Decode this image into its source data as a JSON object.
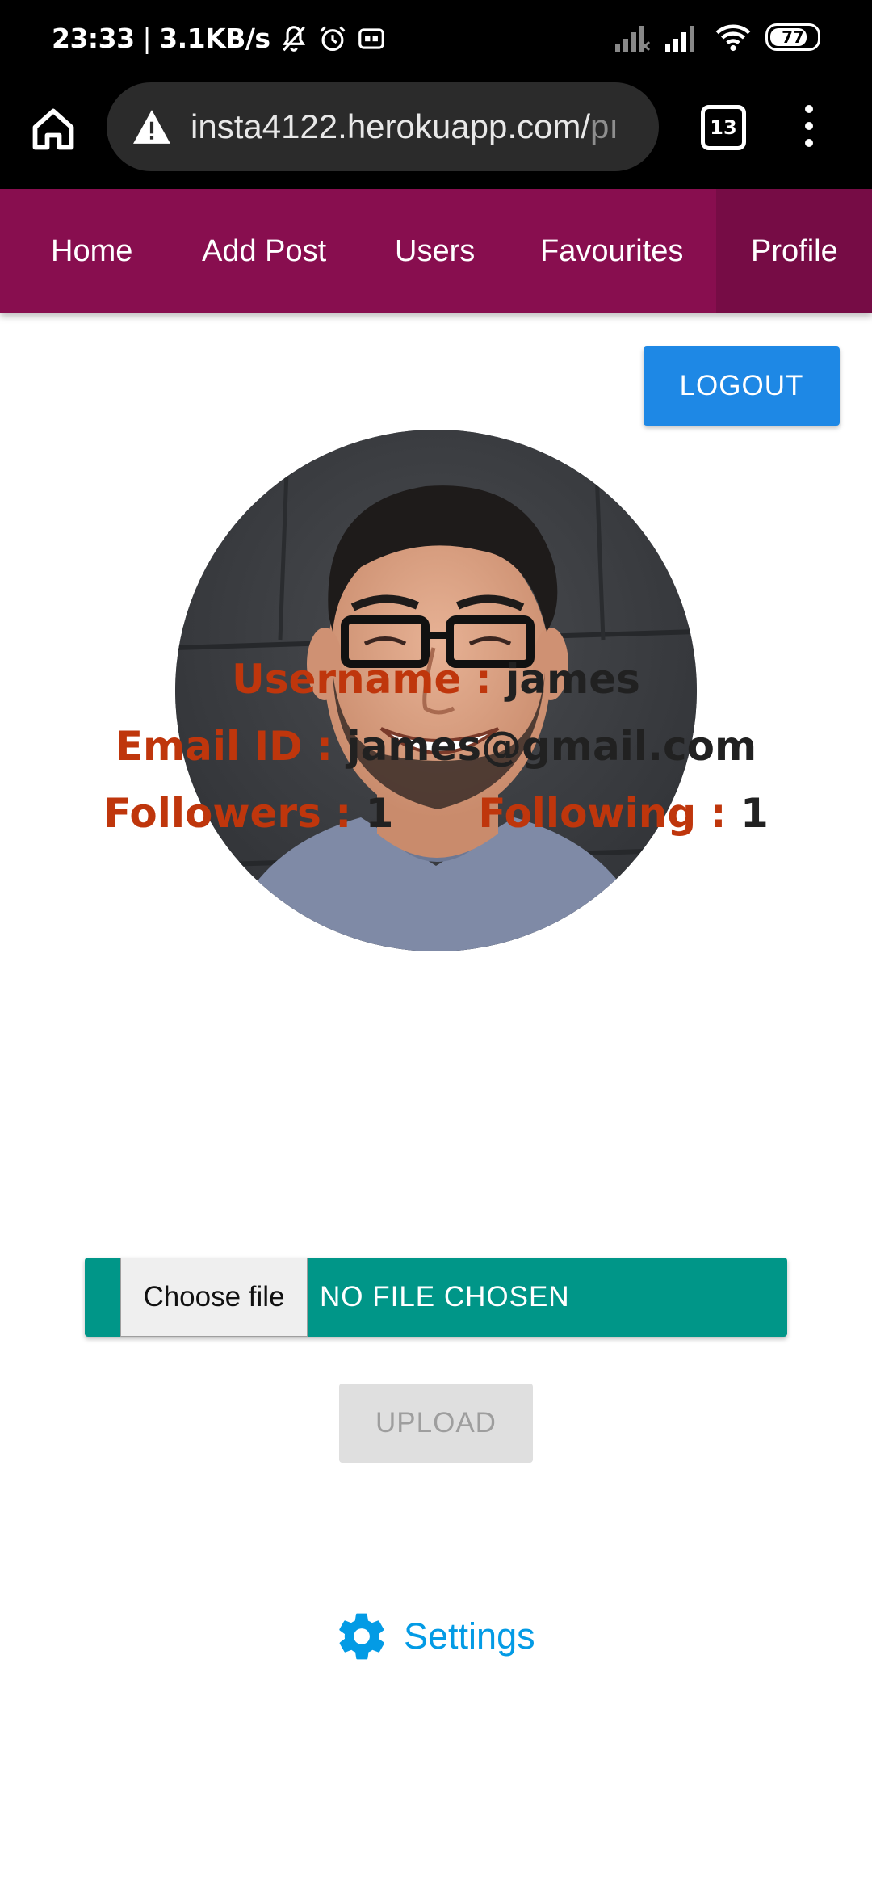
{
  "status_bar": {
    "time": "23:33",
    "separator": "|",
    "speed": "3.1KB/s",
    "battery": "77",
    "icons": [
      "bell-off-icon",
      "alarm-icon",
      "vr-icon",
      "signal-icon",
      "signal-icon",
      "wifi-icon",
      "battery-icon"
    ]
  },
  "browser": {
    "url_main": "insta4122.herokuapp.com/",
    "url_cut": "pı",
    "tabs_count": "13",
    "icons": [
      "home-icon",
      "warning-icon",
      "more-vert-icon"
    ]
  },
  "nav": {
    "items": [
      {
        "label": "Home"
      },
      {
        "label": "Add Post"
      },
      {
        "label": "Users"
      },
      {
        "label": "Favourites"
      },
      {
        "label": "Profile",
        "active": true
      }
    ],
    "color": "#880e4f"
  },
  "profile": {
    "logout_label": "LOGOUT",
    "username_label": "Username :",
    "username": "james",
    "email_label": "Email ID :",
    "email": "james@gmail.com",
    "followers_label": "Followers :",
    "followers": "1",
    "following_label": "Following :",
    "following": "1"
  },
  "upload": {
    "choose_file_label": "Choose file",
    "no_file_text": "NO FILE CHOSEN",
    "upload_label": "UPLOAD"
  },
  "settings": {
    "label": "Settings",
    "icon": "gear-icon",
    "color": "#039be5"
  }
}
